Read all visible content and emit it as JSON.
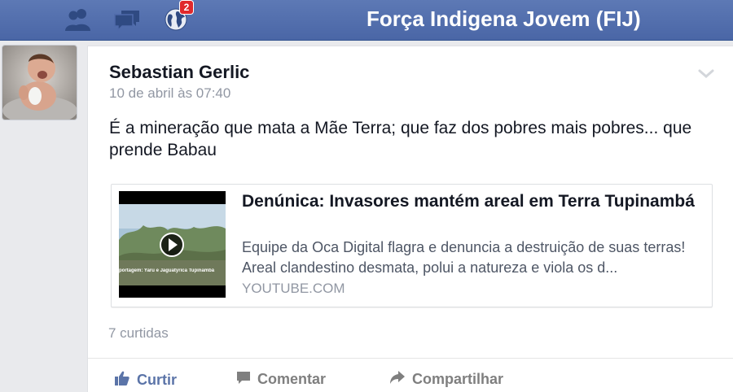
{
  "topbar": {
    "title": "Força Indigena Jovem (FIJ)",
    "notifications_badge": "2",
    "icons": [
      "friends-icon",
      "messages-icon",
      "globe-icon"
    ],
    "bar_color": "#4e69a9"
  },
  "post": {
    "author": "Sebastian Gerlic",
    "timestamp": "10 de abril às 07:40",
    "text": "É a mineração que mata a Mãe Terra; que faz dos pobres mais pobres... que prende Babau",
    "link": {
      "title": "Denúnica: Invasores mantém areal em Terra Tupinambá",
      "description": "Equipe da Oca Digital flagra e denuncia a destruição de suas terras! Areal clandestino desmata, polui a natureza e viola os d...",
      "domain": "YOUTUBE.COM",
      "thumb_caption": "portagem: Yaru e Jaguatyrica Tupinambá"
    },
    "likes": "7 curtidas"
  },
  "actions": {
    "like": "Curtir",
    "comment": "Comentar",
    "share": "Compartilhar"
  },
  "colors": {
    "accent": "#5b74a8",
    "badge": "#e0292c"
  }
}
